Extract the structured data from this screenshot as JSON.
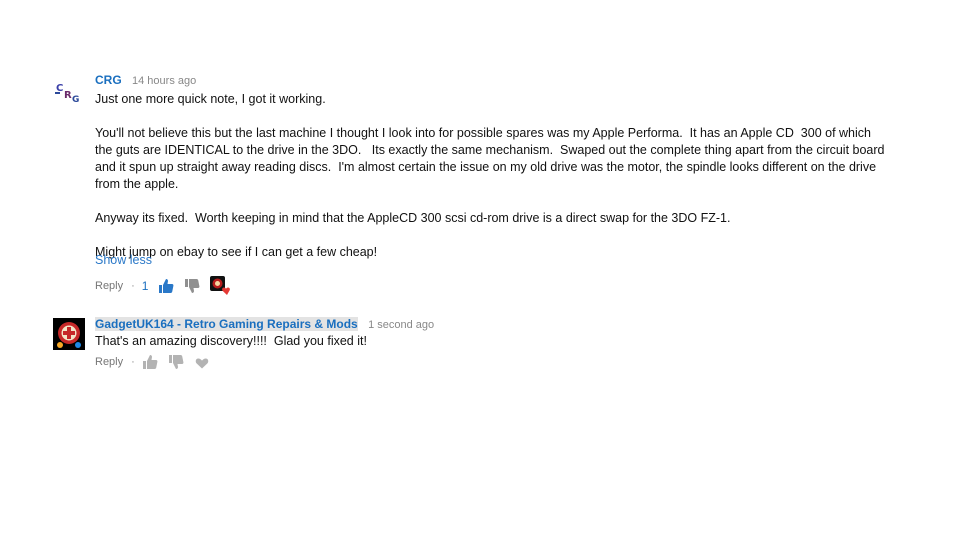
{
  "comments": [
    {
      "author": "CRG",
      "time": "14 hours ago",
      "paragraphs": [
        "Just one more quick note, I got it working.",
        "You'll not believe this but the last machine I thought I look into for possible spares was my Apple Performa.  It has an Apple CD  300 of which the guts are IDENTICAL to the drive in the 3DO.   Its exactly the same mechanism.  Swaped out the complete thing apart from the circuit board and it spun up straight away reading discs.  I'm almost certain the issue on my old drive was the motor, the spindle looks different on the drive from the apple.",
        "Anyway its fixed.  Worth keeping in mind that the AppleCD 300 scsi cd-rom drive is a direct swap for the 3DO FZ-1.",
        "Might jump on ebay to see if I can get a few cheap!"
      ],
      "show_less": "Show less",
      "reply_label": "Reply",
      "separator": "·",
      "like_count": "1"
    },
    {
      "author": "GadgetUK164 - Retro Gaming Repairs & Mods",
      "time": "1 second ago",
      "text": "That's an amazing discovery!!!!  Glad you fixed it!",
      "reply_label": "Reply",
      "separator": "·"
    }
  ],
  "colors": {
    "link": "#1a6fbf",
    "like_active": "#2a78c8",
    "muted": "#767676"
  }
}
